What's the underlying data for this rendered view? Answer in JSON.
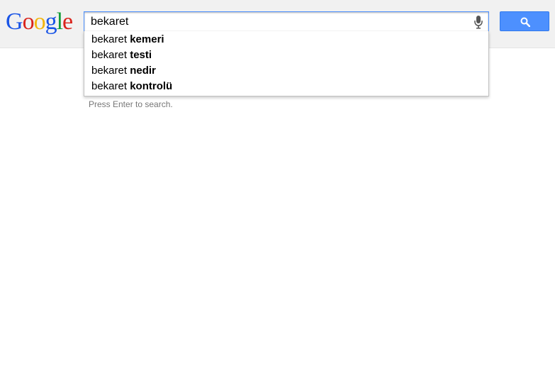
{
  "logo": {
    "letters": [
      "G",
      "o",
      "o",
      "g",
      "l",
      "e"
    ],
    "colors": [
      "#1a55e6",
      "#d9241c",
      "#f2b50f",
      "#1a55e6",
      "#119c38",
      "#d9241c"
    ]
  },
  "search": {
    "query": "bekaret",
    "mic_icon": "microphone-icon",
    "button_icon": "magnifier-icon",
    "accent_color": "#4d90fe"
  },
  "suggestions": [
    {
      "prefix": "bekaret",
      "completion": "kemeri"
    },
    {
      "prefix": "bekaret",
      "completion": "testi"
    },
    {
      "prefix": "bekaret",
      "completion": "nedir"
    },
    {
      "prefix": "bekaret",
      "completion": "kontrolü"
    }
  ],
  "hint": "Press Enter to search."
}
